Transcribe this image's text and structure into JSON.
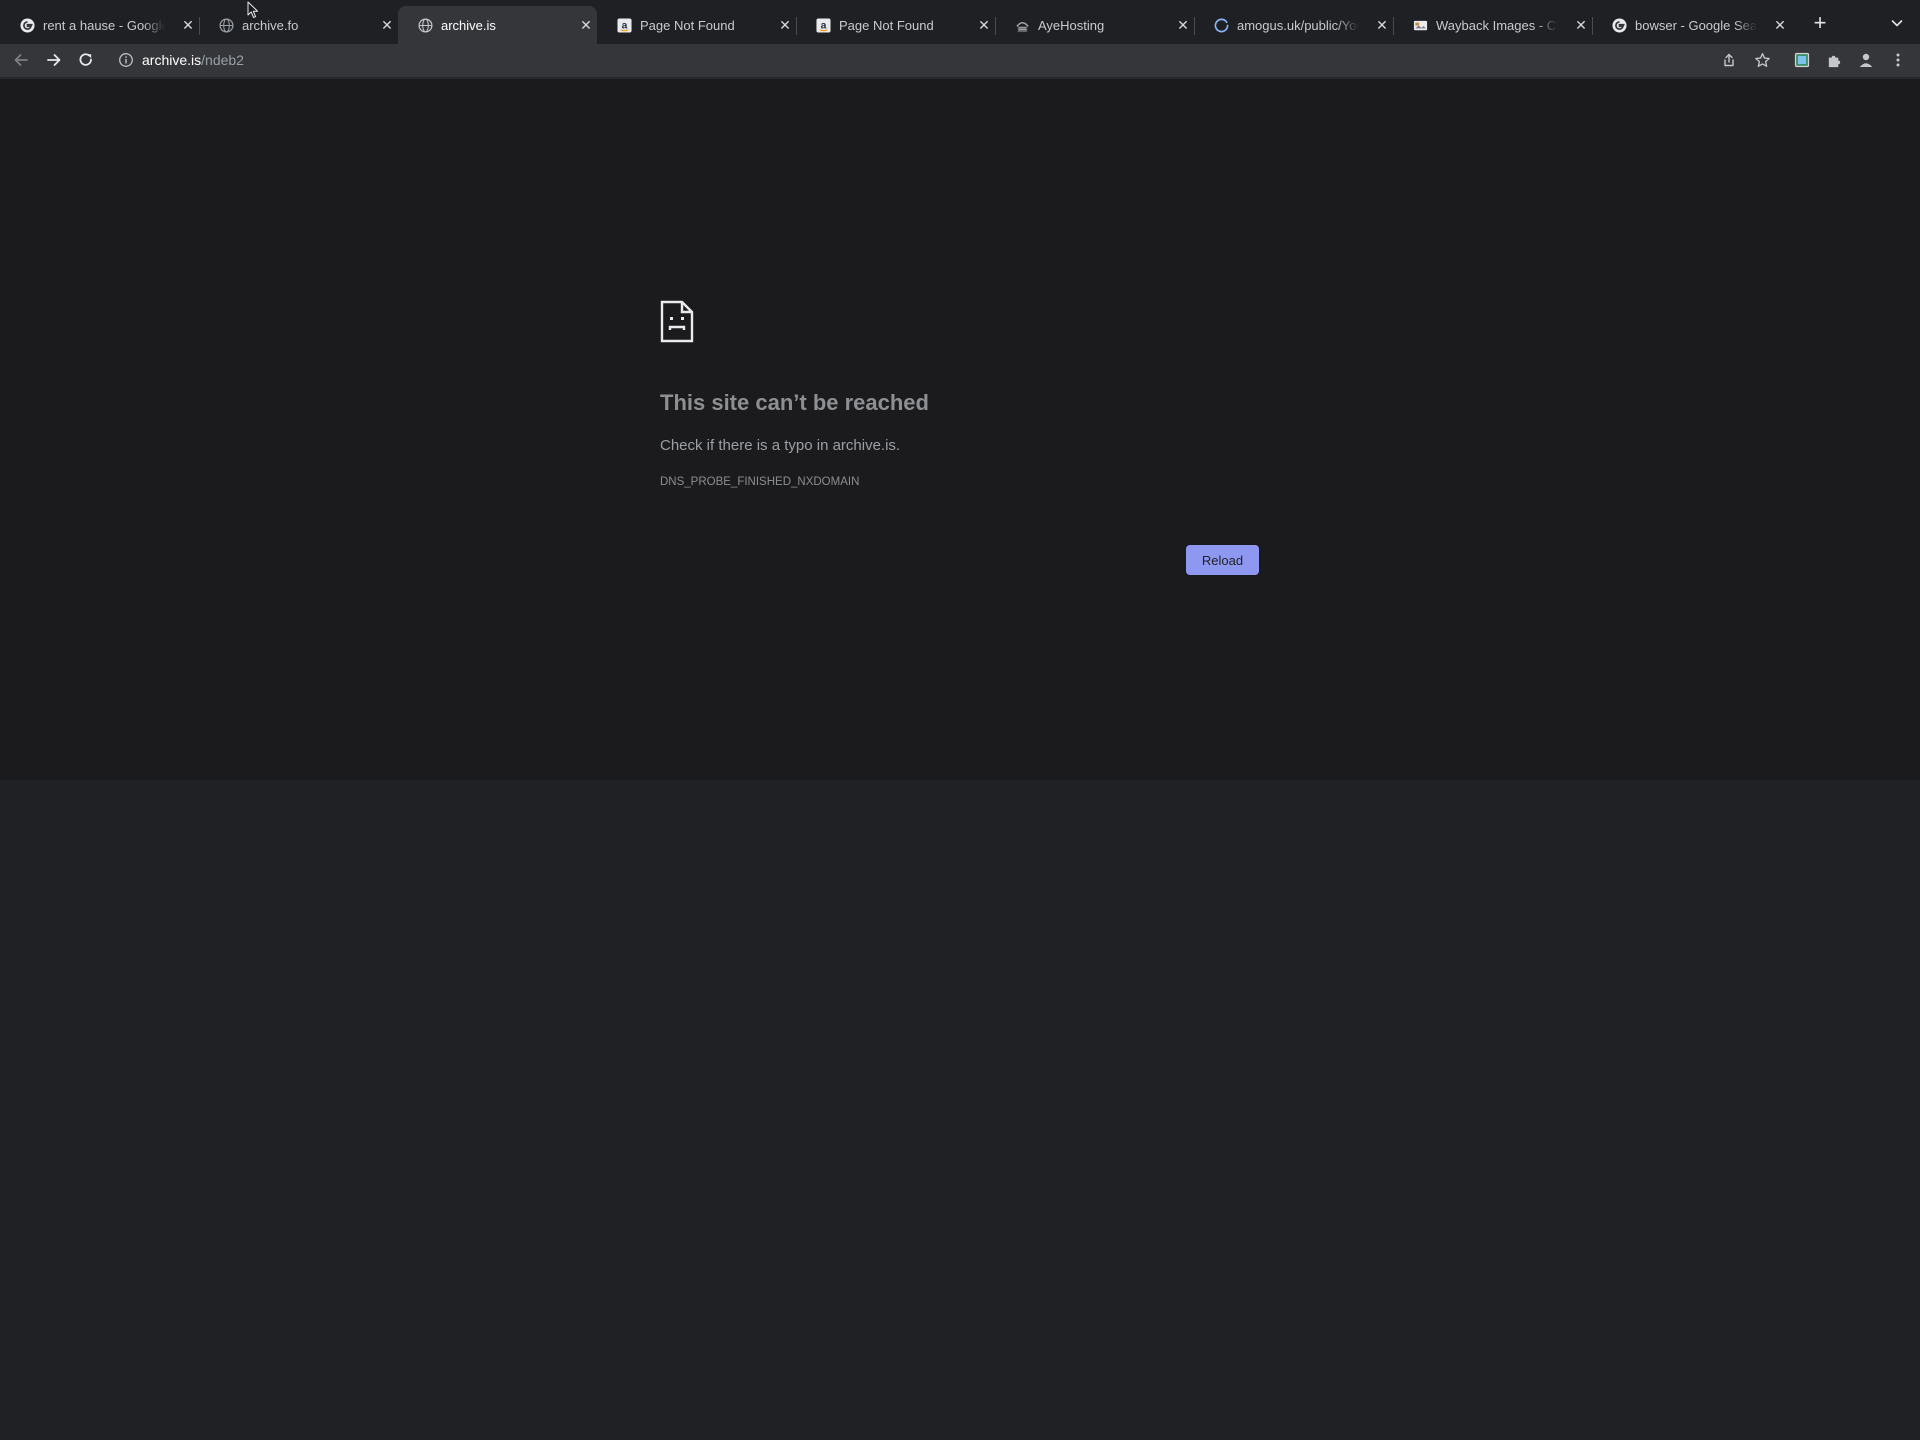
{
  "tabs": [
    {
      "title": "rent a hause - Google Search",
      "favicon": "google-g-icon",
      "active": false
    },
    {
      "title": "archive.fo",
      "favicon": "globe-icon",
      "active": false
    },
    {
      "title": "archive.is",
      "favicon": "globe-icon",
      "active": true
    },
    {
      "title": "Page Not Found",
      "favicon": "amazon-icon",
      "active": false
    },
    {
      "title": "Page Not Found",
      "favicon": "amazon-icon",
      "active": false
    },
    {
      "title": "AyeHosting",
      "favicon": "hfs-icon",
      "active": false
    },
    {
      "title": "amogus.uk/public/You Tube",
      "favicon": "loading-spinner-icon",
      "active": false
    },
    {
      "title": "Wayback Images - Chrome",
      "favicon": "wayback-icon",
      "active": false
    },
    {
      "title": "bowser - Google Search",
      "favicon": "google-g-icon",
      "active": false
    }
  ],
  "new_tab_glyph": "+",
  "close_glyph": "✕",
  "address_bar": {
    "host": "archive.is",
    "path": "/ndeb2"
  },
  "error_page": {
    "title": "This site can’t be reached",
    "message": "Check if there is a typo in archive.is.",
    "code": "DNS_PROBE_FINISHED_NXDOMAIN",
    "reload_label": "Reload"
  },
  "colors": {
    "content_background": "#1b1b1d",
    "lower_background": "#202124",
    "toolbar": "#35363a",
    "reload_button": "#8e98f0"
  }
}
